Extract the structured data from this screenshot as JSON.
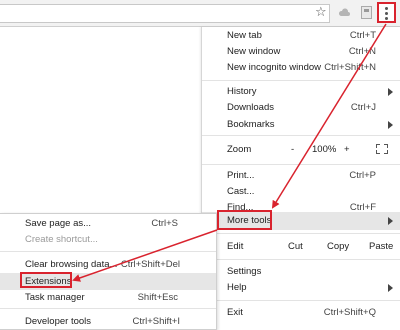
{
  "toolbar": {
    "bookmark_icon": "star-icon",
    "cloud_icon": "cloud-icon",
    "extension_icon": "extension-icon",
    "menu_icon": "vertical-dots-icon"
  },
  "main_menu": {
    "new_tab": {
      "label": "New tab",
      "shortcut": "Ctrl+T"
    },
    "new_window": {
      "label": "New window",
      "shortcut": "Ctrl+N"
    },
    "new_incognito": {
      "label": "New incognito window",
      "shortcut": "Ctrl+Shift+N"
    },
    "history": {
      "label": "History"
    },
    "downloads": {
      "label": "Downloads",
      "shortcut": "Ctrl+J"
    },
    "bookmarks": {
      "label": "Bookmarks"
    },
    "zoom": {
      "label": "Zoom",
      "minus": "-",
      "value": "100%",
      "plus": "+"
    },
    "print": {
      "label": "Print...",
      "shortcut": "Ctrl+P"
    },
    "cast": {
      "label": "Cast..."
    },
    "find": {
      "label": "Find...",
      "shortcut": "Ctrl+F"
    },
    "more_tools": {
      "label": "More tools"
    },
    "edit": {
      "label": "Edit",
      "cut": "Cut",
      "copy": "Copy",
      "paste": "Paste"
    },
    "settings": {
      "label": "Settings"
    },
    "help": {
      "label": "Help"
    },
    "exit": {
      "label": "Exit",
      "shortcut": "Ctrl+Shift+Q"
    }
  },
  "sub_menu": {
    "save_page": {
      "label": "Save page as...",
      "shortcut": "Ctrl+S"
    },
    "create_shortcut": {
      "label": "Create shortcut..."
    },
    "clear_browsing": {
      "label": "Clear browsing data...",
      "shortcut": "Ctrl+Shift+Del"
    },
    "extensions": {
      "label": "Extensions"
    },
    "task_manager": {
      "label": "Task manager",
      "shortcut": "Shift+Esc"
    },
    "developer_tools": {
      "label": "Developer tools",
      "shortcut": "Ctrl+Shift+I"
    }
  },
  "annotation": {
    "color": "#d9232e"
  }
}
